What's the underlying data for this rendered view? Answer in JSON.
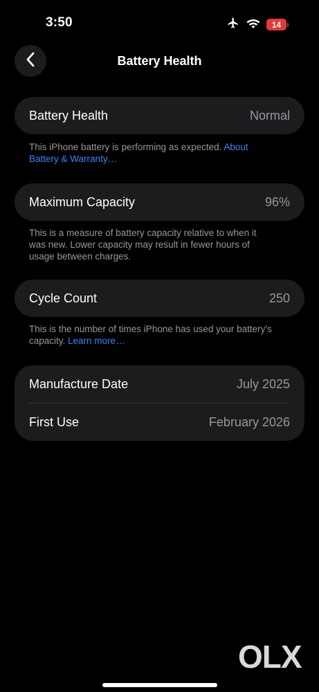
{
  "status_bar": {
    "time": "3:50",
    "battery_level": "14",
    "battery_fraction": 0.14,
    "icons": [
      "airplane-icon",
      "wifi-icon",
      "battery-icon"
    ]
  },
  "nav": {
    "back_icon": "chevron-left-icon",
    "title": "Battery Health"
  },
  "sections": {
    "health": {
      "label": "Battery Health",
      "value": "Normal",
      "footnote_text": "This iPhone battery is performing as expected. ",
      "footnote_link": "About Battery & Warranty…"
    },
    "capacity": {
      "label": "Maximum Capacity",
      "value": "96%",
      "footnote_text": "This is a measure of battery capacity relative to when it was new. Lower capacity may result in fewer hours of usage between charges."
    },
    "cycles": {
      "label": "Cycle Count",
      "value": "250",
      "footnote_text": "This is the number of times iPhone has used your battery's capacity. ",
      "footnote_link": "Learn more…"
    },
    "dates": {
      "manufacture_label": "Manufacture Date",
      "manufacture_value": "July 2025",
      "first_use_label": "First Use",
      "first_use_value": "February 2026"
    }
  },
  "watermark": "OLX",
  "colors": {
    "background": "#000000",
    "card": "#1c1c1e",
    "secondary_text": "#98989d",
    "link": "#3b82f6",
    "battery_low": "#e5383b"
  }
}
